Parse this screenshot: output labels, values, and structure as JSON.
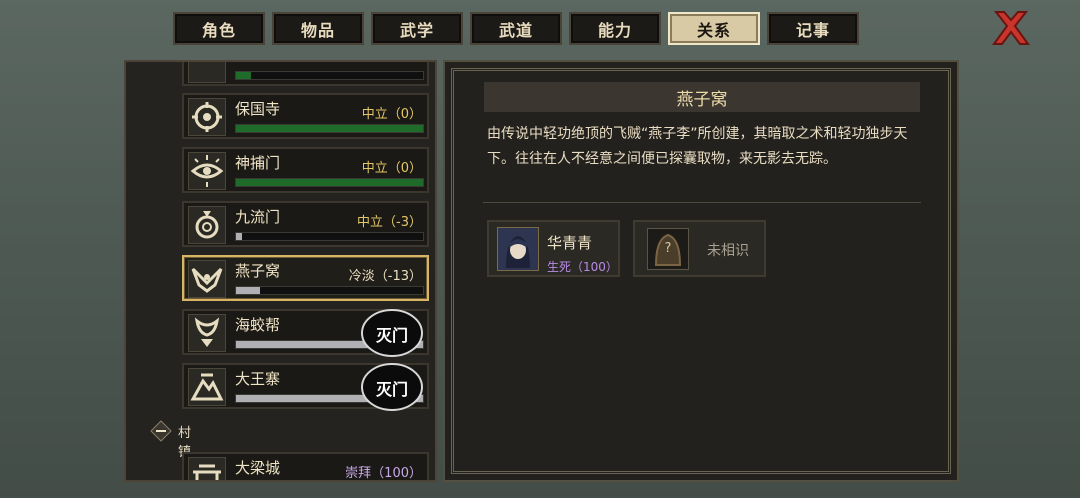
{
  "tabs": [
    {
      "label": "角色"
    },
    {
      "label": "物品"
    },
    {
      "label": "武学"
    },
    {
      "label": "武道"
    },
    {
      "label": "能力"
    },
    {
      "label": "关系",
      "active": true
    },
    {
      "label": "记事"
    }
  ],
  "close_icon": "close-x-icon",
  "factions": [
    {
      "name": "",
      "status": "",
      "reputation_fraction": 0.08,
      "bar_color": "green"
    },
    {
      "name": "保国寺",
      "status": "中立（0）",
      "reputation_fraction": 1.0,
      "bar_color": "green"
    },
    {
      "name": "神捕门",
      "status": "中立（0）",
      "reputation_fraction": 1.0,
      "bar_color": "green"
    },
    {
      "name": "九流门",
      "status": "中立（-3）",
      "reputation_fraction": 0.03,
      "bar_color": "grey"
    },
    {
      "name": "燕子窝",
      "status": "冷淡（-13）",
      "reputation_fraction": 0.13,
      "bar_color": "grey",
      "selected": true
    },
    {
      "name": "海蛟帮",
      "status": "",
      "reputation_fraction": 1.0,
      "bar_color": "grey",
      "stamp": "灭门"
    },
    {
      "name": "大王寨",
      "status": "",
      "reputation_fraction": 1.0,
      "bar_color": "grey",
      "stamp": "灭门"
    }
  ],
  "section": {
    "label": "村镇"
  },
  "town": {
    "name": "大梁城",
    "status": "崇拜（100）"
  },
  "detail": {
    "title": "燕子窝",
    "description": "由传说中轻功绝顶的飞贼“燕子李”所创建，其暗取之术和轻功独步天下。往往在人不经意之间便已探囊取物，来无影去无踪。",
    "members": [
      {
        "name": "华青青",
        "relation": "生死（100）"
      },
      {
        "name": "未相识",
        "unknown_mark": "?"
      }
    ]
  },
  "colors": {
    "accent_gold": "#d8b466",
    "rep_green": "#1f6b2a",
    "rep_grey": "#b0b0b4",
    "relation_purple": "#b88be6",
    "close_red": "#c9352c"
  }
}
